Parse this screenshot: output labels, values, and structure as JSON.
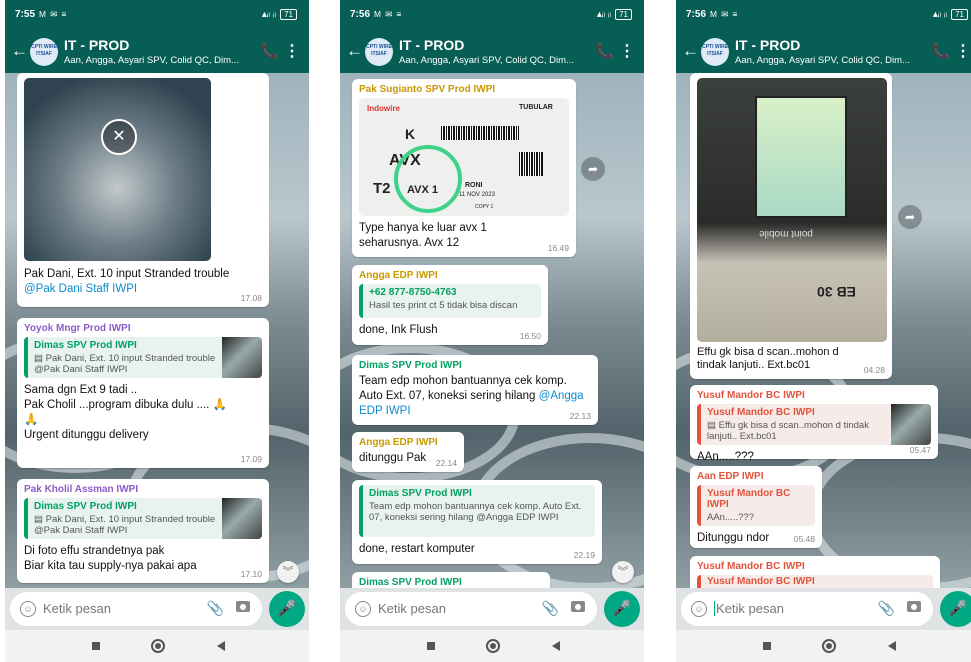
{
  "colors": {
    "header": "#075e54",
    "quote_green": "#06a064",
    "link": "#0b8ad1",
    "mic": "#00a884"
  },
  "chat": {
    "title": "IT - PROD",
    "subtitle": "Aan, Angga, Asyari SPV, Colid QC, Dim...",
    "avatar_text": "CPTI WIRE ITSIAF"
  },
  "input": {
    "placeholder": "Ketik pesan"
  },
  "phones": [
    {
      "status_time": "7:55",
      "status_icons": "M ✉ ≡",
      "messages": [
        {
          "text": "Pak Dani, Ext. 10 input Stranded trouble ",
          "mention": "@Pak Dani Staff IWPI",
          "time": "17.08"
        },
        {
          "sender": "Yoyok Mngr Prod IWPI",
          "quote_name": "Dimas SPV Prod IWPI",
          "quote_text": "▤ Pak Dani, Ext. 10 input Stranded trouble @Pak Dani Staff IWPI",
          "lines": [
            "Sama dgn Ext 9 tadi ..",
            "Pak Cholil ...program dibuka dulu .... 🙏",
            "🙏",
            "Urgent ditunggu delivery"
          ],
          "time": "17.09"
        },
        {
          "sender": "Pak Kholil Assman IWPI",
          "quote_name": "Dimas SPV Prod IWPI",
          "quote_text": "▤ Pak Dani, Ext. 10 input Stranded trouble @Pak Dani Staff IWPI",
          "lines": [
            "Di foto effu strandetnya pak",
            "Biar kita tau supply-nya pakai apa"
          ],
          "time": "17.10"
        }
      ]
    },
    {
      "status_time": "7:56",
      "status_icons": "M ✉ ≡",
      "messages": [
        {
          "sender": "Pak Sugianto SPV Prod IWPI",
          "img_labels": [
            "K",
            "AVX",
            "T2",
            "AVX 1",
            "RONI",
            "11 NOV 2023",
            "COPY 1",
            "Indowire",
            "TUBULAR"
          ],
          "text": "Type hanya ke luar avx 1 seharusnya. Avx 12",
          "time": "16.49"
        },
        {
          "sender": "Angga EDP IWPI",
          "quote_name": "+62 877-8750-4763",
          "quote_text": "Hasil tes print ct 5 tidak bisa discan",
          "text": "done, Ink Flush",
          "time": "16.50"
        },
        {
          "sender": "Dimas SPV Prod IWPI",
          "text": "Team edp mohon bantuannya cek komp. Auto Ext. 07, koneksi sering hilang ",
          "mention": "@Angga EDP IWPI",
          "time": "22.13"
        },
        {
          "sender": "Angga EDP IWPI",
          "text": "ditunggu Pak",
          "time": "22.14"
        },
        {
          "quote_name": "Dimas SPV Prod IWPI",
          "quote_text": "Team edp mohon bantuannya cek komp. Auto Ext. 07, koneksi sering hilang @Angga EDP IWPI",
          "text": "done, restart komputer",
          "time": "22.19"
        },
        {
          "sender": "Dimas SPV Prod IWPI"
        }
      ]
    },
    {
      "status_time": "7:56",
      "status_icons": "M ✉ ≡",
      "messages": [
        {
          "img_labels": [
            "EB 30",
            "point mobile"
          ],
          "text": "Effu gk bisa d scan..mohon d tindak lanjuti.. Ext.bc01",
          "time": "04.28"
        },
        {
          "sender": "Yusuf Mandor BC IWPI",
          "quote_name": "Yusuf Mandor BC IWPI",
          "quote_text": "▤ Effu gk bisa d scan..mohon d tindak lanjuti.. Ext.bc01",
          "text": "AAn.....???",
          "time": "05.47"
        },
        {
          "sender": "Aan EDP IWPI",
          "quote_name": "Yusuf Mandor BC IWPI",
          "quote_text": "AAn.....???",
          "text": "Ditunggu ndor",
          "time": "05.48"
        },
        {
          "sender": "Yusuf Mandor BC IWPI",
          "quote_name": "Yusuf Mandor BC IWPI"
        }
      ]
    }
  ]
}
